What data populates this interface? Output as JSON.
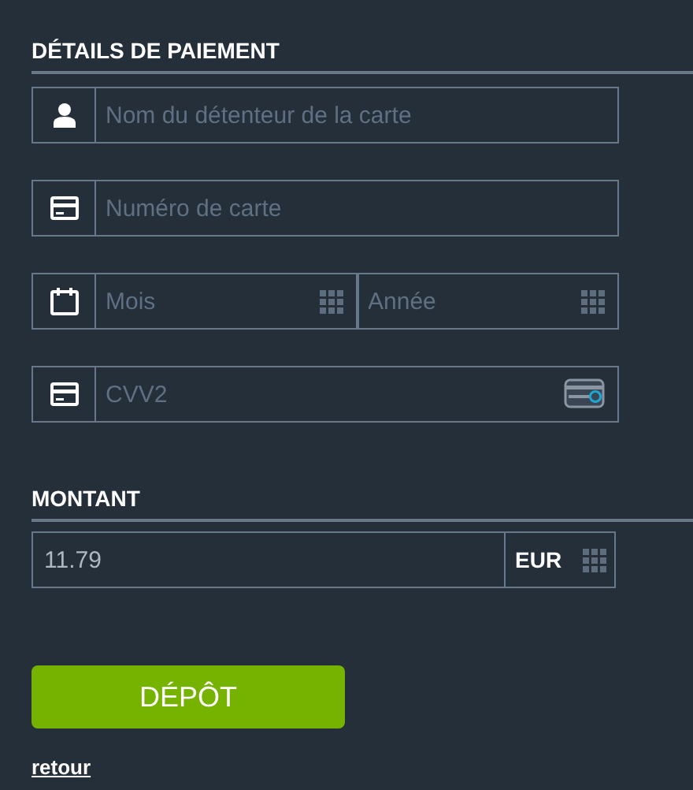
{
  "payment_details": {
    "title": "DÉTAILS DE PAIEMENT",
    "fields": [
      {
        "kind": "person",
        "placeholder": "Nom du détenteur de la carte"
      },
      {
        "kind": "card",
        "placeholder": "Numéro de carte"
      },
      {
        "kind": "date",
        "parts": [
          {
            "placeholder": "Mois"
          },
          {
            "placeholder": "Année"
          }
        ]
      },
      {
        "kind": "cvv",
        "placeholder": "CVV2"
      }
    ]
  },
  "amount": {
    "title": "MONTANT",
    "value": "11.79",
    "currency": "EUR"
  },
  "submit_button": "DÉPÔT",
  "back_link": "retour"
}
